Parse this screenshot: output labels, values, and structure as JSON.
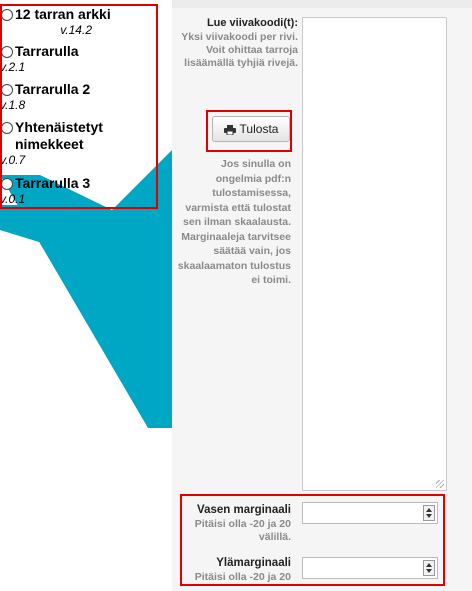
{
  "label_types": [
    {
      "title": "12 tarran arkki",
      "version": "v.14.2"
    },
    {
      "title": "Tarrarulla",
      "version": "v.2.1"
    },
    {
      "title": "Tarrarulla 2",
      "version": "v.1.8"
    },
    {
      "title": "Yhtenäistetyt nimekkeet",
      "version": "v.0.7"
    },
    {
      "title": "Tarrarulla 3",
      "version": "v.0.1"
    }
  ],
  "barcode": {
    "label": "Lue viivakoodi(t):",
    "help": "Yksi viivakoodi per rivi. Voit ohittaa tarroja lisäämällä tyhjiä rivejä.",
    "value": ""
  },
  "print_button": {
    "label": "Tulosta",
    "icon": "print-icon"
  },
  "pdf_note": "Jos sinulla on ongelmia pdf:n tulostamisessa, varmista että tulostat sen ilman skaalausta. Marginaaleja tarvitsee säätää vain, jos skaalaamaton tulostus ei toimi.",
  "left_margin": {
    "label": "Vasen marginaali",
    "help": "Pitäisi olla -20 ja 20 välillä.",
    "value": ""
  },
  "top_margin": {
    "label": "Ylämarginaali",
    "help": "Pitäisi olla -20 ja 20",
    "value": ""
  },
  "colors": {
    "accent_teal": "#00a7c4",
    "highlight_red": "#e00000",
    "panel_bg": "#f5f5f5"
  }
}
